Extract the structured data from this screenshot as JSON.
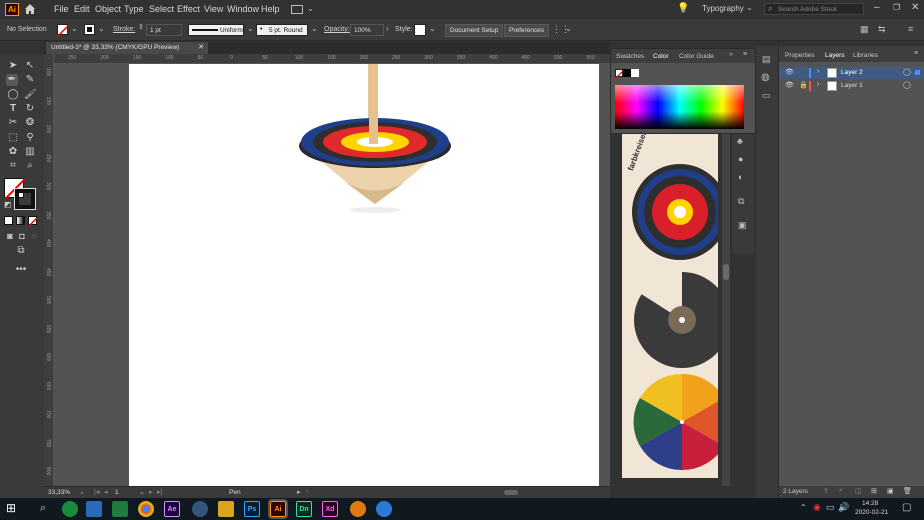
{
  "app": {
    "logo": "Ai",
    "menu": [
      "File",
      "Edit",
      "Object",
      "Type",
      "Select",
      "Effect",
      "View",
      "Window",
      "Help"
    ],
    "workspace": "Typography",
    "search_placeholder": "Search Adobe Stock"
  },
  "control_bar": {
    "selection": "No Selection",
    "stroke_label": "Stroke:",
    "stroke_value": "1 pt",
    "profile_value": "Uniform",
    "brush_value": "5 pt. Round",
    "opacity_label": "Opacity:",
    "opacity_value": "100%",
    "style_label": "Style:",
    "document_setup": "Document Setup",
    "preferences": "Preferences"
  },
  "document": {
    "tab_title": "Untitled-3* @ 33,33% (CMYK/GPU Preview)",
    "ruler_h": [
      "250",
      "200",
      "150",
      "100",
      "50",
      "0",
      "50",
      "100",
      "150",
      "200",
      "250",
      "300",
      "350",
      "400",
      "450",
      "500",
      "550",
      "600"
    ],
    "ruler_v": [
      "100",
      "150",
      "200",
      "250",
      "300",
      "350",
      "400",
      "450",
      "500",
      "550",
      "600",
      "650",
      "700",
      "750",
      "800"
    ]
  },
  "status_bar": {
    "zoom": "33,33%",
    "artboard_number": "1",
    "tool_name": "Pen"
  },
  "color_panel": {
    "tabs": [
      "Swatches",
      "Color",
      "Color Guide"
    ],
    "active_tab": "Color"
  },
  "layers_panel": {
    "tabs": [
      "Properties",
      "Layers",
      "Libraries"
    ],
    "active_tab": "Layers",
    "layers": [
      {
        "name": "Layer 2",
        "selected": true,
        "color": "#4f8cff"
      },
      {
        "name": "Layer 1",
        "selected": false,
        "color": "#ff4f4f"
      }
    ],
    "footer_count": "2 Layers"
  },
  "placed_image": {
    "label": "farbkreisel"
  },
  "taskbar": {
    "apps": [
      "Ae",
      "Ps",
      "Ai",
      "Dn",
      "Xd"
    ],
    "time": "14:28",
    "date": "2020-02-21"
  }
}
